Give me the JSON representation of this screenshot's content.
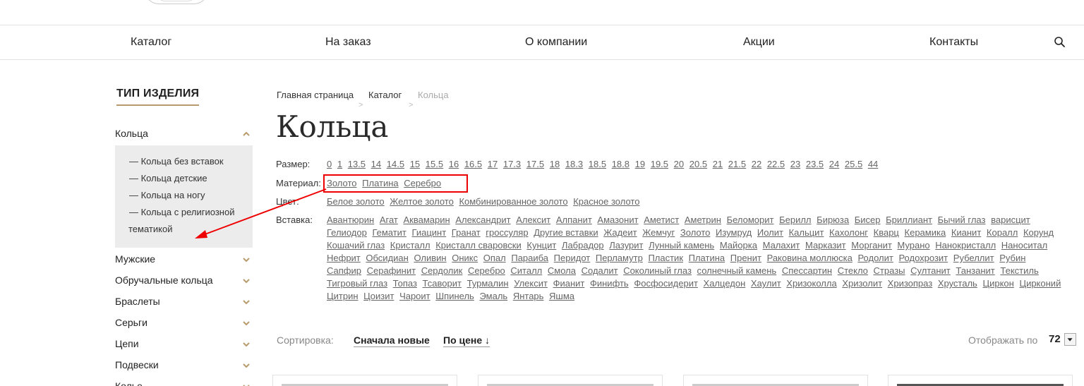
{
  "nav": {
    "items": [
      "Каталог",
      "На заказ",
      "О компании",
      "Акции",
      "Контакты"
    ]
  },
  "sidebar": {
    "title": "ТИП ИЗДЕЛИЯ",
    "categories": [
      "Кольца",
      "Мужские",
      "Обручальные кольца",
      "Браслеты",
      "Серьги",
      "Цепи",
      "Подвески",
      "Колье"
    ],
    "subitems": [
      "— Кольца без вставок",
      "— Кольца детские",
      "— Кольца на ногу",
      "— Кольца с религиозной",
      "тематикой"
    ]
  },
  "breadcrumb": {
    "items": [
      "Главная страница",
      "Каталог",
      "Кольца"
    ],
    "separator": ">"
  },
  "page_title": "Кольца",
  "filters": {
    "size": {
      "label": "Размер:",
      "values": [
        "0",
        "1",
        "13.5",
        "14",
        "14.5",
        "15",
        "15.5",
        "16",
        "16.5",
        "17",
        "17.3",
        "17.5",
        "18",
        "18.3",
        "18.5",
        "18.8",
        "19",
        "19.5",
        "20",
        "20.5",
        "21",
        "21.5",
        "22",
        "22.5",
        "23",
        "23.5",
        "24",
        "25.5",
        "44"
      ]
    },
    "material": {
      "label": "Материал:",
      "values": [
        "Золото",
        "Платина",
        "Серебро"
      ]
    },
    "color": {
      "label": "Цвет:",
      "values": [
        "Белое золото",
        "Желтое золото",
        "Комбинированное золото",
        "Красное золото"
      ]
    },
    "insert": {
      "label": "Вставка:",
      "values": [
        "Авантюрин",
        "Агат",
        "Аквамарин",
        "Александрит",
        "Алексит",
        "Алпанит",
        "Амазонит",
        "Аметист",
        "Аметрин",
        "Беломорит",
        "Берилл",
        "Бирюза",
        "Бисер",
        "Бриллиант",
        "Бычий глаз",
        "варисцит",
        "Гелиодор",
        "Гематит",
        "Гиацинт",
        "Гранат",
        "гроссуляр",
        "Другие вставки",
        "Жадеит",
        "Жемчуг",
        "Золото",
        "Изумруд",
        "Иолит",
        "Кальцит",
        "Кахолонг",
        "Кварц",
        "Керамика",
        "Кианит",
        "Коралл",
        "Корунд",
        "Кошачий глаз",
        "Кристалл",
        "Кристалл сваровски",
        "Кунцит",
        "Лабрадор",
        "Лазурит",
        "Лунный камень",
        "Майорка",
        "Малахит",
        "Марказит",
        "Морганит",
        "Мурано",
        "Нанокристалл",
        "Наноситал",
        "Нефрит",
        "Обсидиан",
        "Оливин",
        "Оникс",
        "Опал",
        "Параиба",
        "Перидот",
        "Перламутр",
        "Пластик",
        "Платина",
        "Пренит",
        "Раковина моллюска",
        "Родолит",
        "Родохрозит",
        "Рубеллит",
        "Рубин",
        "Сапфир",
        "Серафинит",
        "Сердолик",
        "Серебро",
        "Ситалл",
        "Смола",
        "Содалит",
        "Соколиный глаз",
        "солнечный камень",
        "Спессартин",
        "Стекло",
        "Стразы",
        "Султанит",
        "Танзанит",
        "Текстиль",
        "Тигровый глаз",
        "Топаз",
        "Тсаворит",
        "Турмалин",
        "Улексит",
        "Фианит",
        "Финифть",
        "Фосфосидерит",
        "Халцедон",
        "Хаулит",
        "Хризоколла",
        "Хризолит",
        "Хризопраз",
        "Хрусталь",
        "Циркон",
        "Цирконий",
        "Цитрин",
        "Цоизит",
        "Чароит",
        "Шпинель",
        "Эмаль",
        "Янтарь",
        "Яшма"
      ]
    }
  },
  "sort": {
    "label": "Сортировка:",
    "newest": "Сначала новые",
    "price": "По цене ↓"
  },
  "display": {
    "label": "Отображать по",
    "value": "72"
  },
  "colors": {
    "accent": "#b89b6c",
    "annotation": "#e00000"
  }
}
